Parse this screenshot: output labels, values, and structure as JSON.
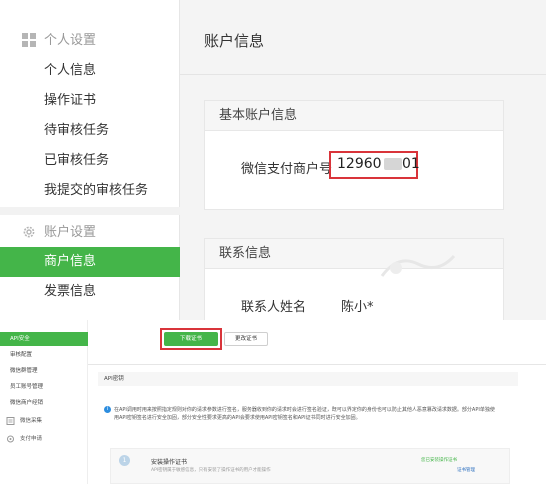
{
  "top": {
    "sidebar": {
      "personal_section": {
        "icon": "grid-icon",
        "label": "个人设置"
      },
      "personal_items": [
        "个人信息",
        "操作证书",
        "待审核任务",
        "已审核任务",
        "我提交的审核任务"
      ],
      "account_section": {
        "icon": "gear-icon",
        "label": "账户设置"
      },
      "account_items": [
        "商户信息",
        "发票信息"
      ],
      "active_item": "商户信息"
    },
    "main": {
      "page_title": "账户信息",
      "basic_panel": {
        "title": "基本账户信息",
        "merchant_label": "微信支付商户号",
        "merchant_value_start": "12960",
        "merchant_value_end": "01"
      },
      "contact_panel": {
        "title": "联系信息",
        "name_label": "联系人姓名",
        "name_value": "陈小*"
      }
    }
  },
  "bottom": {
    "sidebar": {
      "items": [
        "API安全",
        "审核配置",
        "微信群管理",
        "员工账号管理",
        "微信商户经销"
      ],
      "active_item": "API安全",
      "sections": [
        {
          "icon": "document-icon",
          "label": "微信采集"
        },
        {
          "icon": "gear-icon",
          "label": "支付申请"
        }
      ]
    },
    "main": {
      "download_cert_button": "下载证书",
      "change_cert_button": "更改证书",
      "api_section_title": "API密钥",
      "notice_text": "在API调用时用来按照指定规则对你的请求参数进行签名，服务器收到你的请求时会进行签名验证，既可以界定你的身份也可以防止其他人恶意篡改请求数据。部分API单独使用API密钥签名进行安全加固，部分安全性要求更高的API会要求使用API密钥签名和API证书同时进行安全加固。",
      "step": {
        "number": "1",
        "title": "安装操作证书",
        "desc": "API密钥属于敏感信息，只有安装了操作证书的用户才能操作",
        "status": "您已安装操作证书",
        "link": "证书管理"
      }
    }
  }
}
